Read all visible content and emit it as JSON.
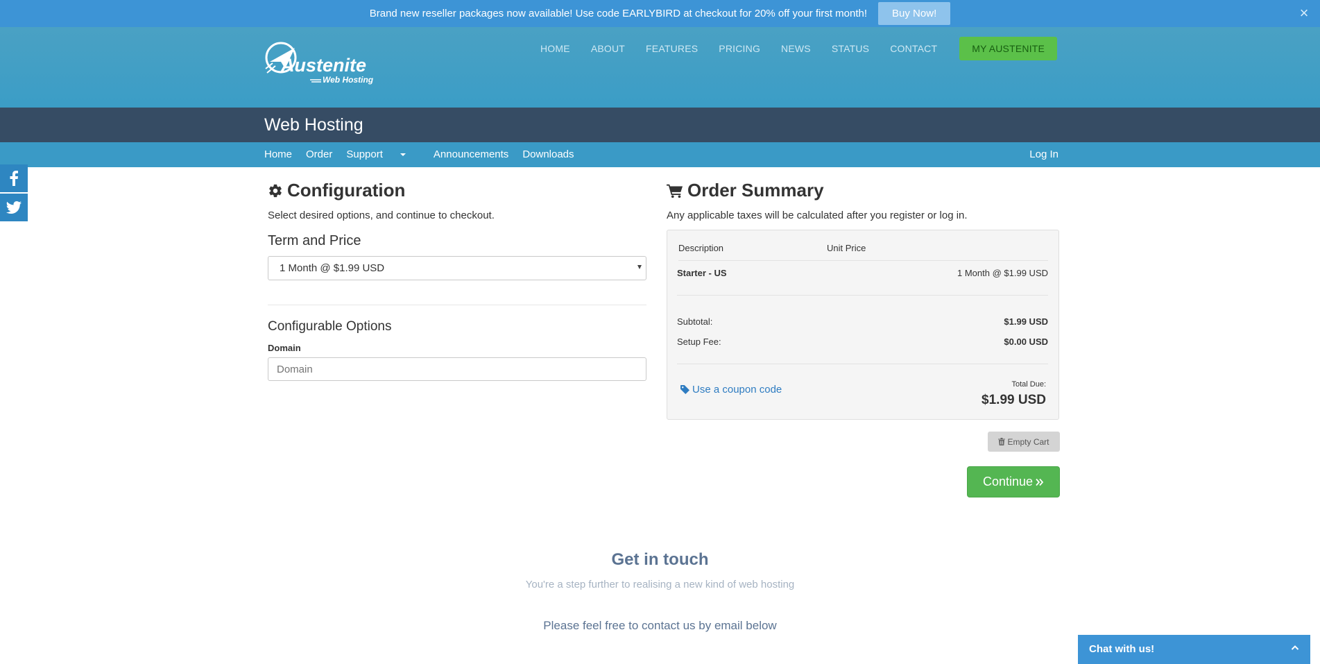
{
  "promo": {
    "text": "Brand new reseller packages now available! Use code EARLYBIRD at checkout for 20% off your first month!",
    "button": "Buy Now!"
  },
  "brand": {
    "name": "Austenite",
    "tagline": "Web Hosting"
  },
  "topnav": [
    "HOME",
    "ABOUT",
    "FEATURES",
    "PRICING",
    "NEWS",
    "STATUS",
    "CONTACT"
  ],
  "topnav_cta": "MY AUSTENITE",
  "page_title": "Web Hosting",
  "subnav": {
    "items": [
      "Home",
      "Order",
      "Support",
      "Announcements",
      "Downloads"
    ],
    "login": "Log In"
  },
  "configuration": {
    "title": "Configuration",
    "lead": "Select desired options, and continue to checkout.",
    "term_heading": "Term and Price",
    "term_value": "1 Month @ $1.99 USD",
    "options_heading": "Configurable Options",
    "domain_label": "Domain",
    "domain_placeholder": "Domain"
  },
  "summary": {
    "title": "Order Summary",
    "lead": "Any applicable taxes will be calculated after you register or log in.",
    "col_description": "Description",
    "col_unit_price": "Unit Price",
    "item_name": "Starter - US",
    "item_price": "1 Month @ $1.99 USD",
    "subtotal_label": "Subtotal:",
    "subtotal_value": "$1.99 USD",
    "setup_label": "Setup Fee:",
    "setup_value": "$0.00 USD",
    "coupon_link": "Use a coupon code",
    "total_label": "Total Due:",
    "total_value": "$1.99 USD"
  },
  "buttons": {
    "empty_cart": "Empty Cart",
    "continue": "Continue"
  },
  "footer": {
    "heading": "Get in touch",
    "tagline": "You're a step further to realising a new kind of web hosting",
    "contact": "Please feel free to contact us by email below"
  },
  "chat": {
    "label": "Chat with us!"
  },
  "colors": {
    "promo_bg": "#3d94d6",
    "header_bg": "#3b9dc6",
    "titlebar_bg": "#364c64",
    "accent_green": "#54b652",
    "link_blue": "#2e7cc1"
  }
}
